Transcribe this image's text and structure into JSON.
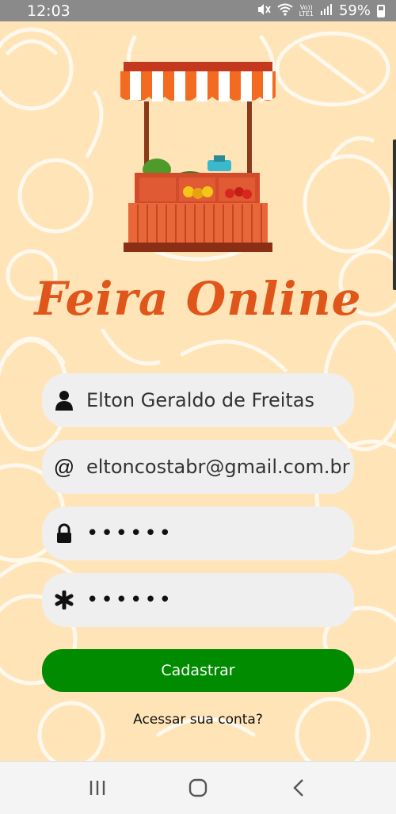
{
  "status_bar": {
    "time": "12:03",
    "network_top": "Vo))",
    "network_bottom": "LTE1",
    "battery": "59%",
    "icons": [
      "mute-icon",
      "wifi-icon",
      "signal-icon",
      "battery-icon"
    ]
  },
  "app": {
    "title": "Feira Online",
    "logo": "market-stall-logo"
  },
  "form": {
    "name": {
      "icon": "person-icon",
      "value": "Elton Geraldo de Freitas"
    },
    "email": {
      "icon": "at-icon",
      "value": "eltoncostabr@gmail.com.br"
    },
    "password": {
      "icon": "lock-icon",
      "value": "••••••"
    },
    "confirm_password": {
      "icon": "asterisk-icon",
      "value": "••••••"
    }
  },
  "actions": {
    "register_label": "Cadastrar",
    "login_link": "Acessar sua conta?"
  },
  "navigation": {
    "buttons": [
      "recents-icon",
      "home-icon",
      "back-icon"
    ]
  },
  "colors": {
    "background": "#ffe4b8",
    "title": "#e0561a",
    "primary_button": "#008b00",
    "field_background": "#efefef"
  }
}
